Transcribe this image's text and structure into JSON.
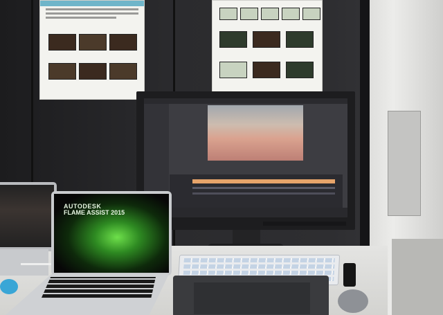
{
  "scene": {
    "laptop_logo": {
      "line1": "AUTODESK",
      "line2": "FLAME ASSIST 2015"
    }
  },
  "colors": {
    "booth_wall": "#2b2b2e",
    "timeline_track": "#e7a46a",
    "flame_green": "#6ee04b",
    "mouse_blue": "#3aa6d6"
  }
}
